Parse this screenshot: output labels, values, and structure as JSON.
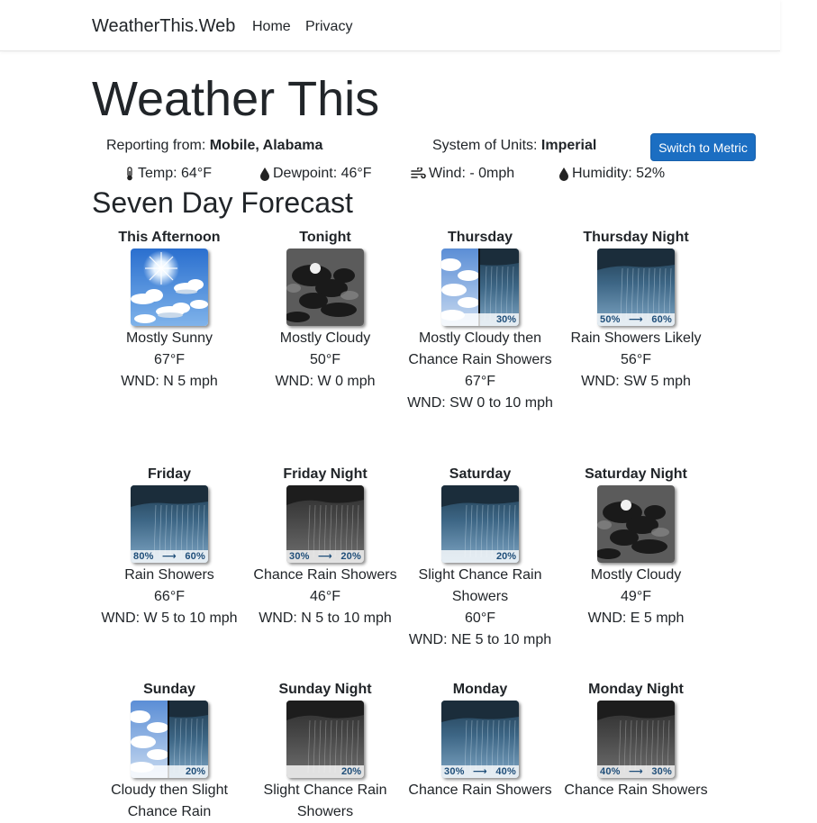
{
  "nav": {
    "brand": "WeatherThis.Web",
    "home": "Home",
    "privacy": "Privacy"
  },
  "title": "Weather This",
  "report": {
    "from_label": "Reporting from: ",
    "location": "Mobile, Alabama",
    "units_label": "System of Units: ",
    "units": "Imperial",
    "switch_label": "Switch to Metric"
  },
  "current": {
    "temp": "Temp: 64°F",
    "dewpoint": "Dewpoint: 46°F",
    "wind": "Wind: - 0mph",
    "humidity": "Humidity: 52%"
  },
  "section_title": "Seven Day Forecast",
  "forecast": [
    {
      "name": "This Afternoon",
      "icon": "sunny-icon",
      "pop": "",
      "short": "Mostly Sunny",
      "temp": "67°F",
      "wind": "WND: N 5 mph"
    },
    {
      "name": "Tonight",
      "icon": "night-cloudy-icon",
      "pop": "",
      "short": "Mostly Cloudy",
      "temp": "50°F",
      "wind": "WND: W 0 mph"
    },
    {
      "name": "Thursday",
      "icon": "cloudy-rain-split-icon",
      "pop": "30%",
      "short": "Mostly Cloudy then Chance Rain Showers",
      "temp": "67°F",
      "wind": "WND: SW 0 to 10 mph"
    },
    {
      "name": "Thursday Night",
      "icon": "rain-showers-icon",
      "pop": "50% ⟶ 60%",
      "short": "Rain Showers Likely",
      "temp": "56°F",
      "wind": "WND: SW 5 mph"
    },
    {
      "name": "Friday",
      "icon": "rain-showers-icon",
      "pop": "80% ⟶ 60%",
      "short": "Rain Showers",
      "temp": "66°F",
      "wind": "WND: W 5 to 10 mph"
    },
    {
      "name": "Friday Night",
      "icon": "rain-showers-night-icon",
      "pop": "30% ⟶ 20%",
      "short": "Chance Rain Showers",
      "temp": "46°F",
      "wind": "WND: N 5 to 10 mph"
    },
    {
      "name": "Saturday",
      "icon": "rain-showers-icon",
      "pop": "20%",
      "short": "Slight Chance Rain Showers",
      "temp": "60°F",
      "wind": "WND: NE 5 to 10 mph"
    },
    {
      "name": "Saturday Night",
      "icon": "night-cloudy-icon",
      "pop": "",
      "short": "Mostly Cloudy",
      "temp": "49°F",
      "wind": "WND: E 5 mph"
    },
    {
      "name": "Sunday",
      "icon": "cloudy-rain-split-icon",
      "pop": "20%",
      "short": "Cloudy then Slight Chance Rain",
      "temp": "",
      "wind": ""
    },
    {
      "name": "Sunday Night",
      "icon": "rain-showers-night-icon",
      "pop": "20%",
      "short": "Slight Chance Rain Showers",
      "temp": "",
      "wind": ""
    },
    {
      "name": "Monday",
      "icon": "rain-showers-icon",
      "pop": "30% ⟶ 40%",
      "short": "Chance Rain Showers",
      "temp": "",
      "wind": ""
    },
    {
      "name": "Monday Night",
      "icon": "rain-showers-night-icon",
      "pop": "40% ⟶ 30%",
      "short": "Chance Rain Showers",
      "temp": "",
      "wind": ""
    }
  ],
  "colors": {
    "button": "#1b6ec2",
    "pop_text": "#1f4e79"
  }
}
